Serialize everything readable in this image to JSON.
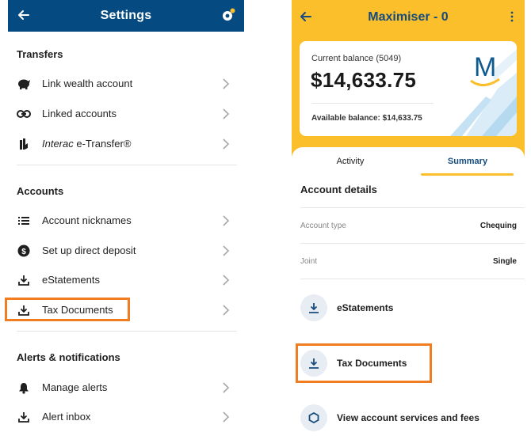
{
  "left": {
    "header_title": "Settings",
    "sections": {
      "transfers": {
        "title": "Transfers",
        "items": [
          {
            "label": "Link wealth account",
            "icon": "piggy-bank-icon"
          },
          {
            "label": "Linked accounts",
            "icon": "link-icon"
          },
          {
            "label_italic": "Interac",
            "label": " e-Transfer®",
            "icon": "interac-icon"
          }
        ]
      },
      "accounts": {
        "title": "Accounts",
        "items": [
          {
            "label": "Account nicknames",
            "icon": "list-icon"
          },
          {
            "label": "Set up direct deposit",
            "icon": "dollar-icon"
          },
          {
            "label": "eStatements",
            "icon": "download-icon"
          },
          {
            "label": "Tax Documents",
            "icon": "download-icon"
          }
        ]
      },
      "alerts": {
        "title": "Alerts & notifications",
        "items": [
          {
            "label": "Manage alerts",
            "icon": "bell-icon"
          },
          {
            "label": "Alert inbox",
            "icon": "download-icon"
          }
        ]
      }
    }
  },
  "right": {
    "header_title": "Maximiser - 0",
    "balance": {
      "label": "Current balance (5049)",
      "amount": "$14,633.75",
      "available": "Available balance: $14,633.75"
    },
    "tabs": {
      "activity": "Activity",
      "summary": "Summary"
    },
    "details_title": "Account details",
    "details": [
      {
        "key": "Account type",
        "value": "Chequing"
      },
      {
        "key": "Joint",
        "value": "Single"
      }
    ],
    "actions": [
      {
        "label": "eStatements",
        "icon": "download-icon"
      },
      {
        "label": "Tax Documents",
        "icon": "download-icon"
      },
      {
        "label": "View account services and fees",
        "icon": "hexagon-icon"
      }
    ]
  },
  "colors": {
    "settings_header": "#054a80",
    "account_header": "#fbbf2c",
    "highlight": "#f07d22",
    "brand_blue": "#154b7e"
  }
}
